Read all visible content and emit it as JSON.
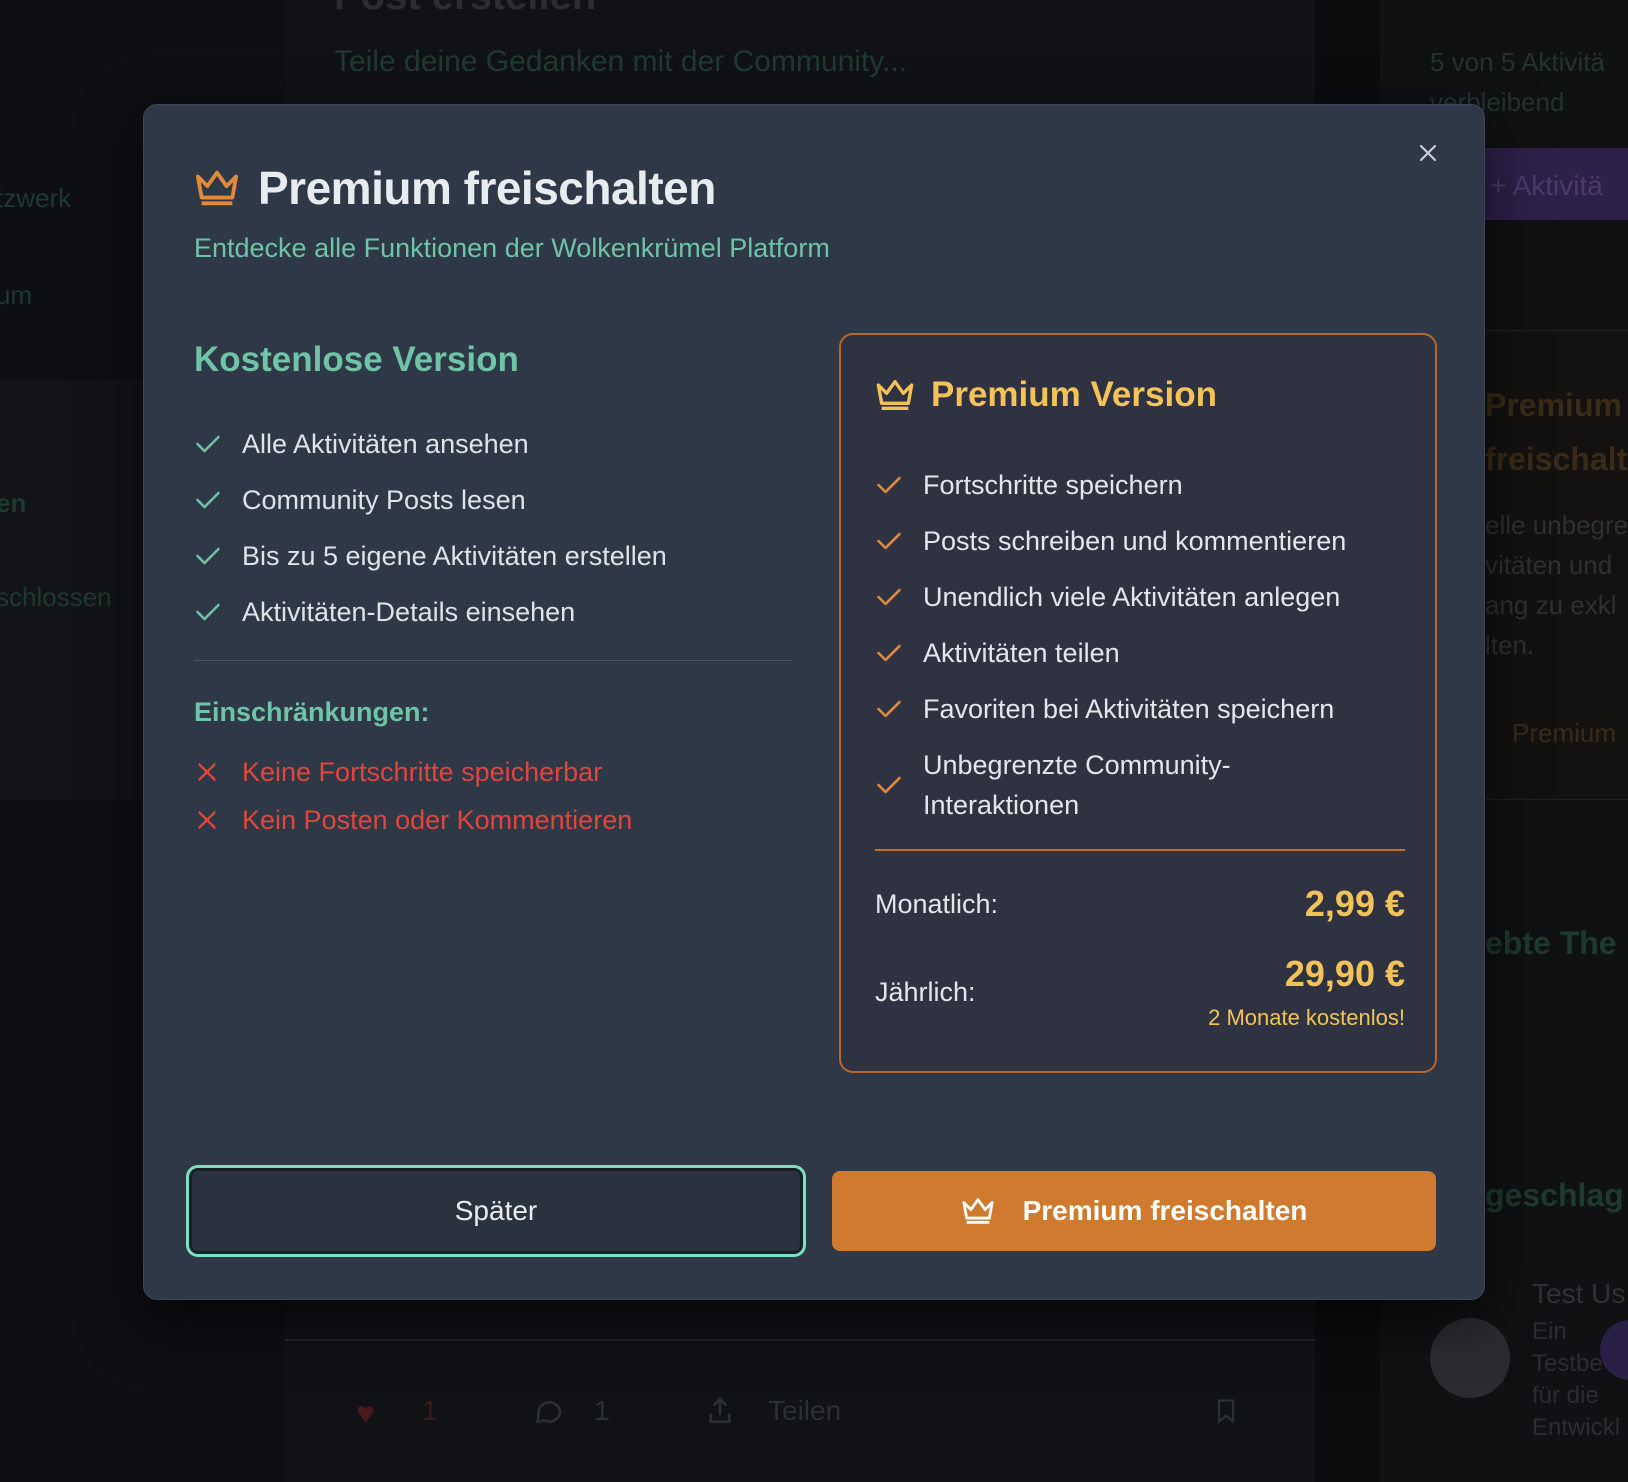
{
  "background": {
    "page_title": "Post erstellen",
    "page_subtitle": "Teile deine Gedanken mit der Community...",
    "left_nav": [
      "tzwerk",
      "um",
      "en",
      "schlossen"
    ],
    "right_counter": "5 von 5 Aktivitä verbleibend",
    "right_button": "+ Aktivitä",
    "right_card_title": "Premium freischalt",
    "right_card_text": "elle unbegre vitäten und ang zu exkl lten.",
    "right_card_btn": "Premium",
    "right_section_1": "ebte The",
    "right_section_2": "geschlag",
    "user_name": "Test Us",
    "user_desc": "Ein Testbe für die Entwickl",
    "post_actions": {
      "likes": "1",
      "comments": "1",
      "share": "Teilen"
    }
  },
  "modal": {
    "title": "Premium freischalten",
    "subtitle": "Entdecke alle Funktionen der Wolkenkrümel Platform",
    "free": {
      "heading": "Kostenlose Version",
      "features": [
        "Alle Aktivitäten ansehen",
        "Community Posts lesen",
        "Bis zu 5 eigene Aktivitäten erstellen",
        "Aktivitäten-Details einsehen"
      ],
      "restrictions_title": "Einschränkungen:",
      "restrictions": [
        "Keine Fortschritte speicherbar",
        "Kein Posten oder Kommentieren"
      ]
    },
    "premium": {
      "heading": "Premium Version",
      "features": [
        "Fortschritte speichern",
        "Posts schreiben und kommentieren",
        "Unendlich viele Aktivitäten anlegen",
        "Aktivitäten teilen",
        "Favoriten bei Aktivitäten speichern",
        "Unbegrenzte Community-Interaktionen"
      ],
      "monthly_label": "Monatlich:",
      "monthly_price": "2,99 €",
      "yearly_label": "Jährlich:",
      "yearly_price": "29,90 €",
      "yearly_note": "2 Monate kostenlos!"
    },
    "buttons": {
      "later": "Später",
      "unlock": "Premium freischalten"
    }
  },
  "colors": {
    "modal_bg": "#2e3847",
    "accent_green": "#6fc3a6",
    "accent_orange": "#cf7a2f",
    "gold": "#f3c35a",
    "error_red": "#e0463c"
  }
}
